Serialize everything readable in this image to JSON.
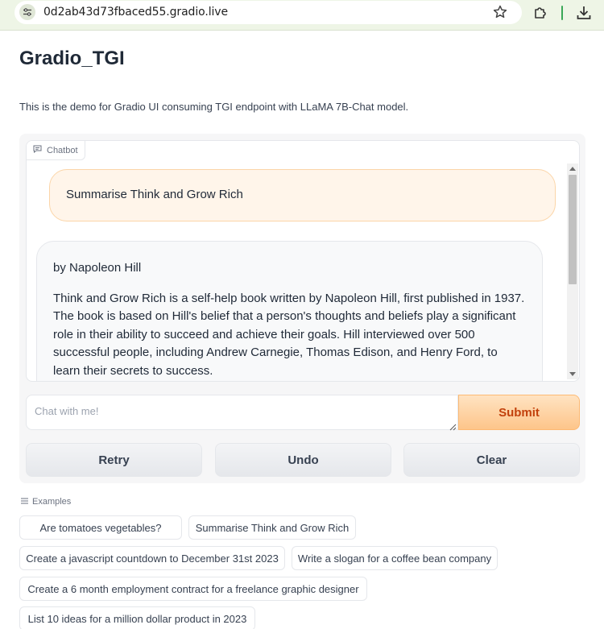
{
  "browser": {
    "url": "0d2ab43d73fbaced55.gradio.live",
    "icons": [
      "site-info-icon",
      "star-icon",
      "extensions-icon",
      "download-icon"
    ]
  },
  "page": {
    "title": "Gradio_TGI",
    "description": "This is the demo for Gradio UI consuming TGI endpoint with LLaMA 7B-Chat model."
  },
  "chatbot": {
    "label": "Chatbot",
    "messages": [
      {
        "role": "user",
        "paragraphs": [
          "Summarise Think and Grow Rich"
        ]
      },
      {
        "role": "bot",
        "paragraphs": [
          "by Napoleon Hill",
          "Think and Grow Rich is a self-help book written by Napoleon Hill, first published in 1937. The book is based on Hill's belief that a person's thoughts and beliefs play a significant role in their ability to succeed and achieve their goals. Hill interviewed over 500 successful people, including Andrew Carnegie, Thomas Edison, and Henry Ford, to learn their secrets to success."
        ]
      }
    ]
  },
  "input": {
    "placeholder": "Chat with me!",
    "value": "",
    "submit_label": "Submit"
  },
  "actions": {
    "retry": "Retry",
    "undo": "Undo",
    "clear": "Clear"
  },
  "examples": {
    "label": "Examples",
    "items": [
      "Are tomatoes vegetables?",
      "Summarise Think and Grow Rich",
      "Create a javascript countdown to December 31st 2023",
      "Write a slogan for a coffee bean company",
      "Create a 6 month employment contract for a freelance graphic designer",
      "List 10 ideas for a million dollar product in 2023"
    ]
  },
  "colors": {
    "accent": "#c2410c",
    "accent_bg": "#fdc58a",
    "user_bubble": "#fff5ea"
  }
}
